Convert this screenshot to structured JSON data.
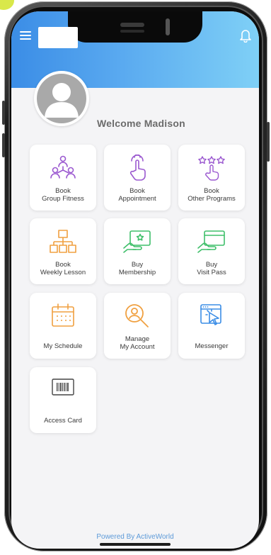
{
  "header": {
    "welcome_text": "Welcome Madison",
    "menu_icon": "hamburger-menu-icon",
    "notification_icon": "bell-icon",
    "gradient_start": "#3b8de6",
    "gradient_end": "#7fd0f6"
  },
  "tiles": [
    {
      "line1": "Book",
      "line2": "Group Fitness",
      "icon": "group-people-icon",
      "color": "#9b59d0"
    },
    {
      "line1": "Book",
      "line2": "Appointment",
      "icon": "hand-pointer-icon",
      "color": "#9b59d0"
    },
    {
      "line1": "Book",
      "line2": "Other Programs",
      "icon": "rating-stars-hand-icon",
      "color": "#9b59d0"
    },
    {
      "line1": "Book",
      "line2": "Weekly Lesson",
      "icon": "org-chart-icon",
      "color": "#f0a040"
    },
    {
      "line1": "Buy",
      "line2": "Membership",
      "icon": "membership-card-hand-icon",
      "color": "#3fbf6a"
    },
    {
      "line1": "Buy",
      "line2": "Visit Pass",
      "icon": "pass-card-hand-icon",
      "color": "#3fbf6a"
    },
    {
      "line1": "My Schedule",
      "line2": "",
      "icon": "calendar-icon",
      "color": "#f0a040"
    },
    {
      "line1": "Manage",
      "line2": "My Account",
      "icon": "account-search-icon",
      "color": "#f0a040"
    },
    {
      "line1": "Messenger",
      "line2": "",
      "icon": "cursor-window-icon",
      "color": "#3b8de6"
    },
    {
      "line1": "Access Card",
      "line2": "",
      "icon": "barcode-icon",
      "color": "#444444"
    }
  ],
  "footer": {
    "text": "Powered By ActiveWorld"
  }
}
